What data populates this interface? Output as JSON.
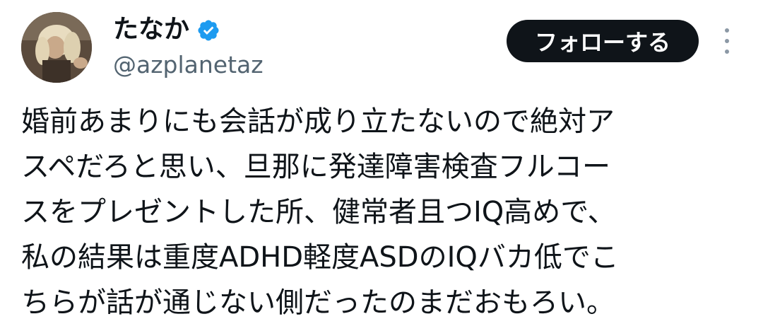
{
  "author": {
    "display_name": "たなか",
    "handle": "@azplanetaz",
    "verified": true,
    "avatar_icon": "profile-photo",
    "verified_icon": "verified-badge-icon"
  },
  "actions": {
    "follow_label": "フォローする",
    "more_icon": "more-options-icon"
  },
  "tweet": {
    "lines": [
      "婚前あまりにも会話が成り立たないので絶対ア",
      "スペだろと思い、旦那に発達障害検査フルコー",
      "スをプレゼントした所、健常者且つIQ高めで、",
      "私の結果は重度ADHD軽度ASDのIQバカ低でこ",
      "ちらが話が通じない側だったのまだおもろい。"
    ]
  },
  "colors": {
    "text": "#0f1419",
    "secondary_text": "#536471",
    "verified": "#1d9bf0",
    "button_bg": "#0f1419",
    "button_text": "#ffffff",
    "background": "#ffffff"
  }
}
